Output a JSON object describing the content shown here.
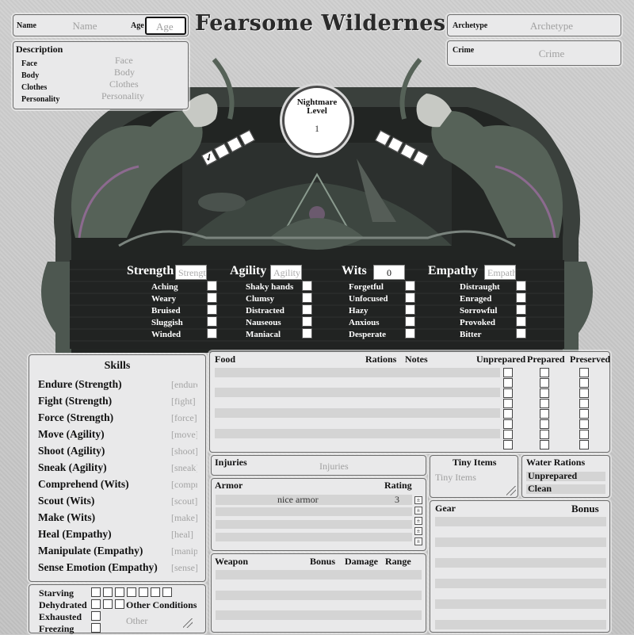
{
  "title": "Fearsome Wilderness",
  "identity": {
    "name_label": "Name",
    "name_placeholder": "Name",
    "age_label": "Age",
    "age_placeholder": "Age",
    "archetype_label": "Archetype",
    "archetype_placeholder": "Archetype",
    "crime_label": "Crime",
    "crime_placeholder": "Crime"
  },
  "description": {
    "heading": "Description",
    "rows": [
      {
        "label": "Face",
        "placeholder": "Face"
      },
      {
        "label": "Body",
        "placeholder": "Body"
      },
      {
        "label": "Clothes",
        "placeholder": "Clothes"
      },
      {
        "label": "Personality",
        "placeholder": "Personality"
      }
    ]
  },
  "nightmare": {
    "label_line1": "Nightmare",
    "label_line2": "Level",
    "value": "1"
  },
  "nightmare_track": {
    "left_checked": 1,
    "left_total": 4,
    "right_checked": 0,
    "right_total": 4,
    "check_mark": "✓"
  },
  "attributes": [
    {
      "name": "Strength",
      "value": "Strength",
      "conditions": [
        "Aching",
        "Weary",
        "Bruised",
        "Sluggish",
        "Winded"
      ]
    },
    {
      "name": "Agility",
      "value": "Agility",
      "conditions": [
        "Shaky hands",
        "Clumsy",
        "Distracted",
        "Nauseous",
        "Maniacal"
      ]
    },
    {
      "name": "Wits",
      "value": "0",
      "conditions": [
        "Forgetful",
        "Unfocused",
        "Hazy",
        "Anxious",
        "Desperate"
      ]
    },
    {
      "name": "Empathy",
      "value": "Empathy",
      "conditions": [
        "Distraught",
        "Enraged",
        "Sorrowful",
        "Provoked",
        "Bitter"
      ]
    }
  ],
  "skills": {
    "heading": "Skills",
    "items": [
      {
        "label": "Endure (Strength)",
        "field": "[endure]"
      },
      {
        "label": "Fight (Strength)",
        "field": "[fight]"
      },
      {
        "label": "Force (Strength)",
        "field": "[force]"
      },
      {
        "label": "Move (Agility)",
        "field": "[move]"
      },
      {
        "label": "Shoot (Agility)",
        "field": "[shoot]"
      },
      {
        "label": "Sneak (Agility)",
        "field": "[sneak]"
      },
      {
        "label": "Comprehend (Wits)",
        "field": "[comprehend]"
      },
      {
        "label": "Scout (Wits)",
        "field": "[scout]"
      },
      {
        "label": "Make (Wits)",
        "field": "[make]"
      },
      {
        "label": "Heal (Empathy)",
        "field": "[heal]"
      },
      {
        "label": "Manipulate (Empathy)",
        "field": "[manipulate]"
      },
      {
        "label": "Sense Emotion (Empathy)",
        "field": "[sense]"
      }
    ]
  },
  "food": {
    "col_food": "Food",
    "col_rations": "Rations",
    "col_notes": "Notes",
    "col_unprepared": "Unprepared",
    "col_prepared": "Prepared",
    "col_preserved": "Preserved"
  },
  "injuries": {
    "label": "Injuries",
    "placeholder": "Injuries"
  },
  "armor": {
    "label": "Armor",
    "rating_label": "Rating",
    "rows": [
      {
        "name": "nice armor",
        "rating": "3"
      }
    ]
  },
  "weapon": {
    "label": "Weapon",
    "bonus": "Bonus",
    "damage": "Damage",
    "range": "Range"
  },
  "tiny_items": {
    "label": "Tiny Items",
    "placeholder": "Tiny Items"
  },
  "water": {
    "label": "Water Rations",
    "unprepared": "Unprepared",
    "clean": "Clean"
  },
  "gear": {
    "label": "Gear",
    "bonus": "Bonus"
  },
  "conditions": {
    "starving": "Starving",
    "dehydrated": "Dehydrated",
    "exhausted": "Exhausted",
    "freezing": "Freezing",
    "other_label": "Other Conditions",
    "other_placeholder": "Other"
  },
  "colors": {
    "panel": "#e9e9ea",
    "art_dark": "#2a2d2b",
    "art_green": "#566258",
    "art_purple": "#8c6a8f"
  }
}
